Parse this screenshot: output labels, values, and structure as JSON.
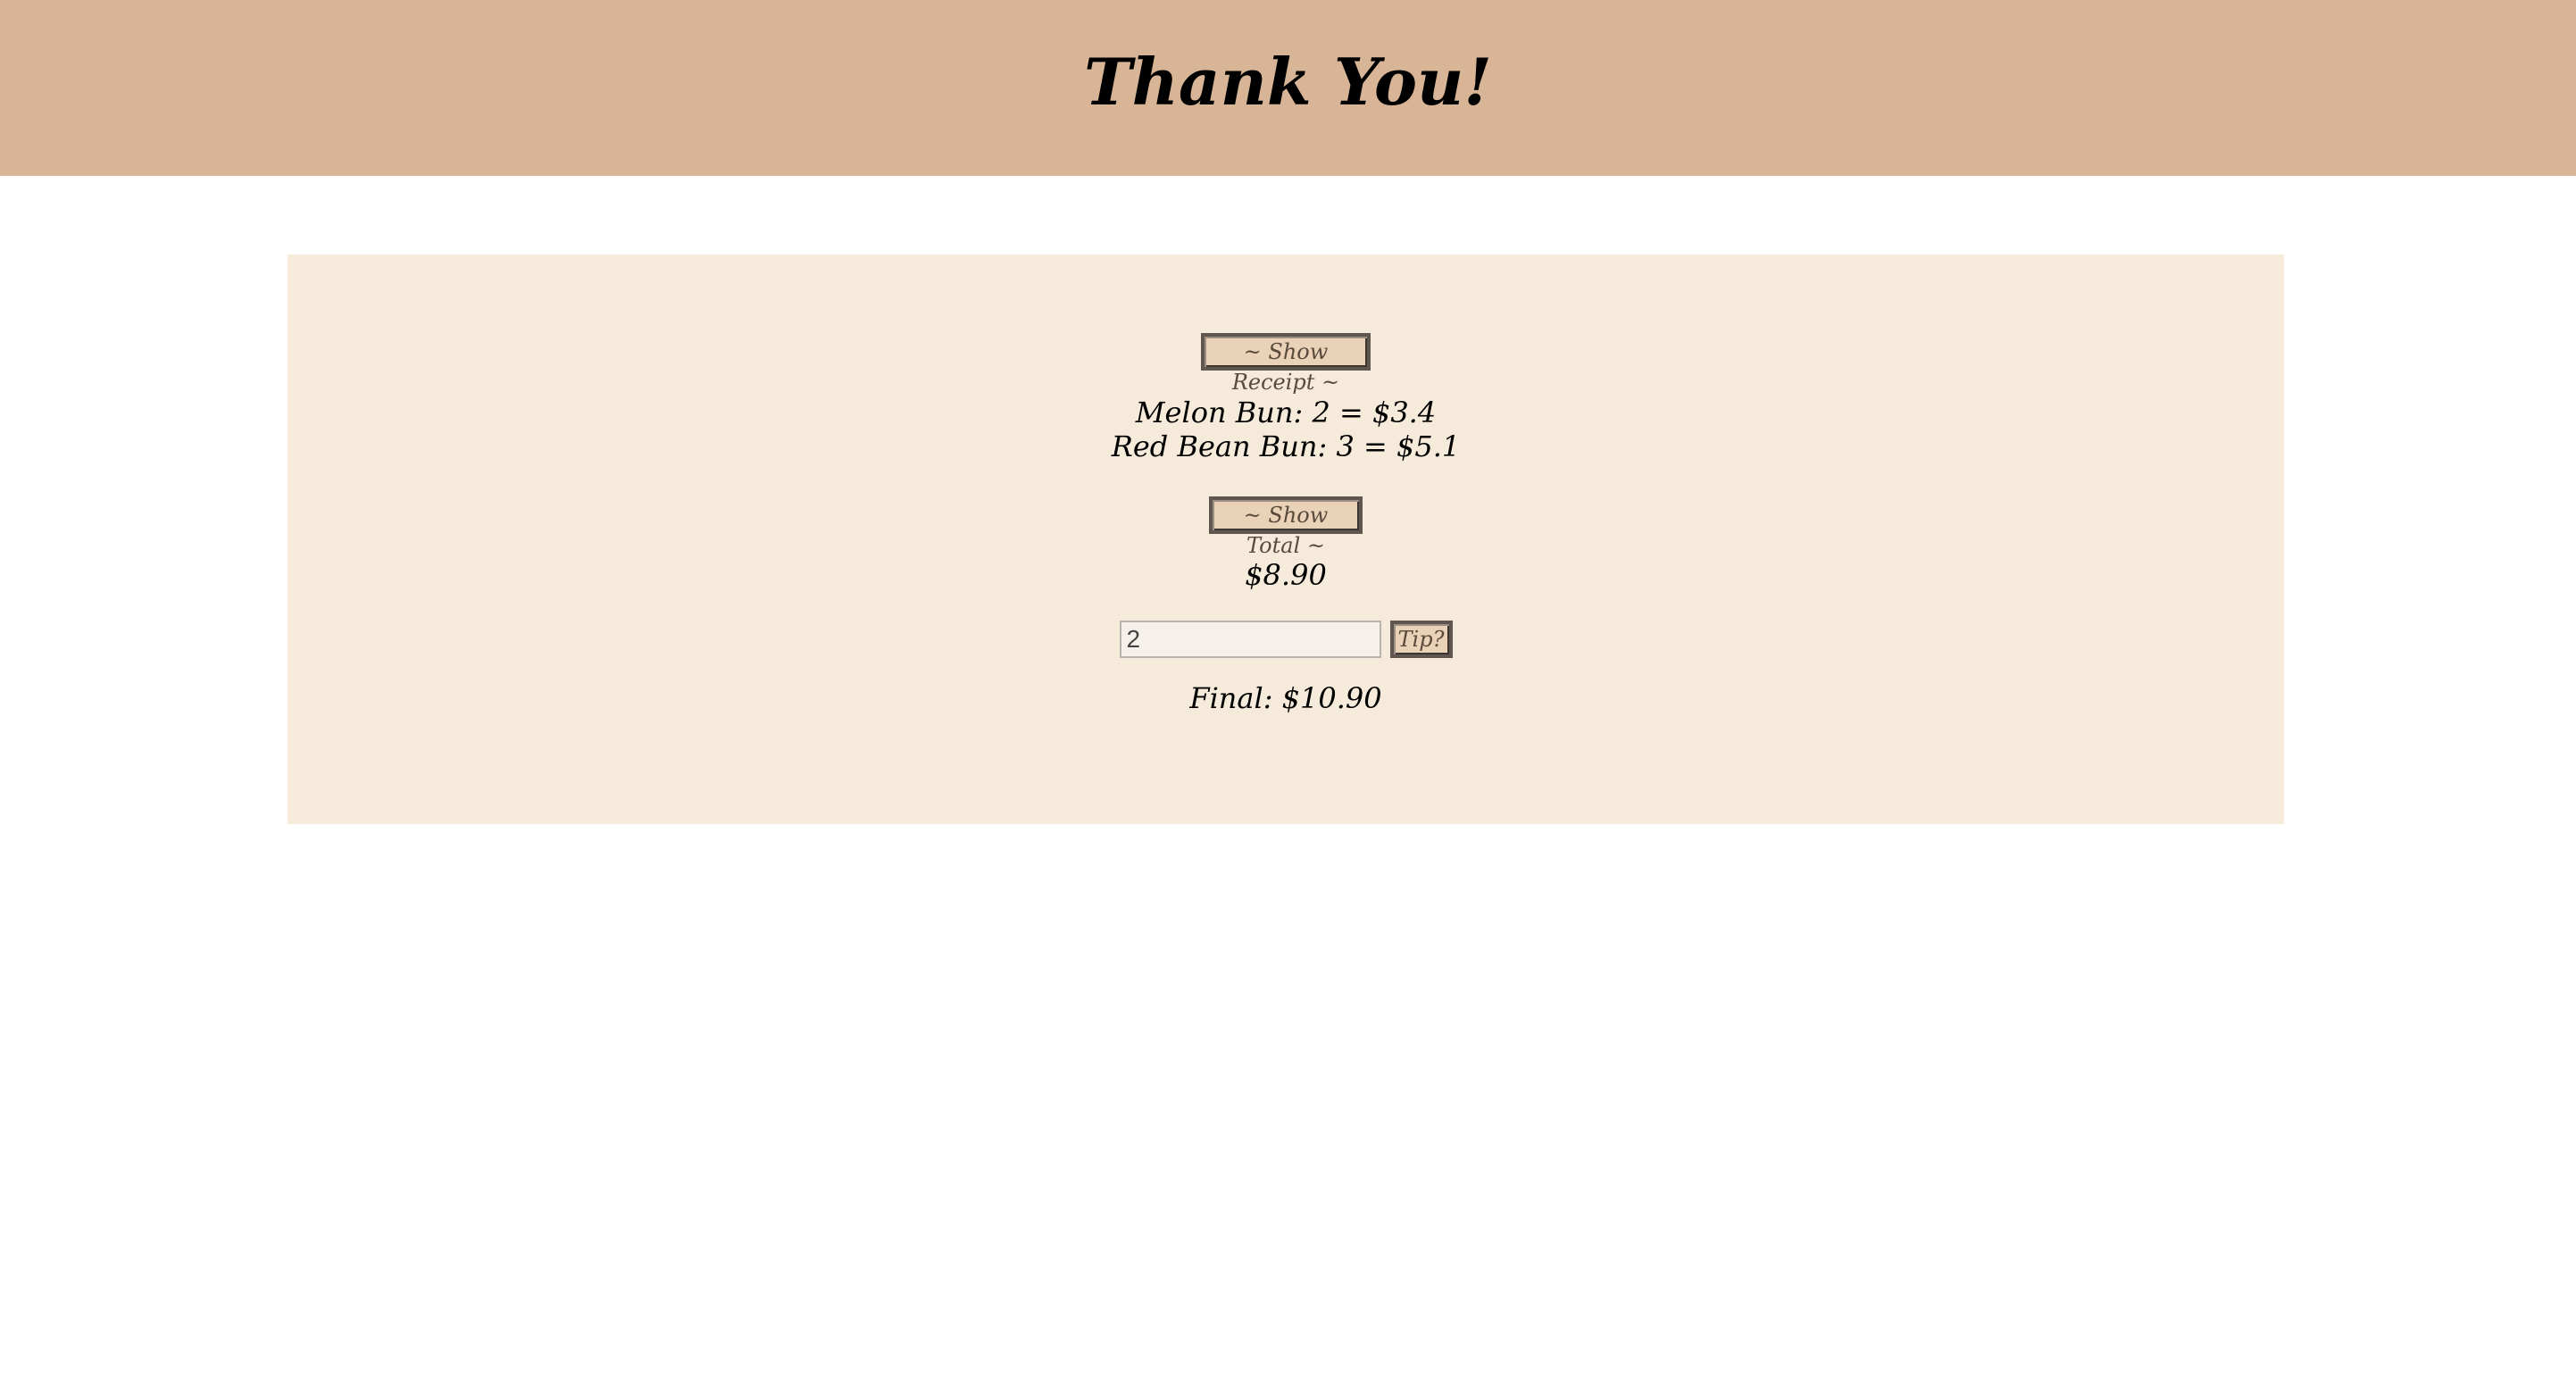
{
  "header": {
    "title": "Thank You!"
  },
  "receipt": {
    "show_receipt_label": "~ Show Receipt ~",
    "items": [
      "Melon Bun: 2 = $3.4",
      "Red Bean Bun: 3 = $5.1"
    ],
    "show_total_label": "~ Show Total ~",
    "total": "$8.90",
    "tip_value": "2",
    "tip_button_label": "Tip?",
    "final": "Final: $10.90"
  },
  "colors": {
    "header_bg": "#d8b596",
    "panel_bg": "#f6ebdb",
    "button_bg": "#e9d2b7"
  }
}
